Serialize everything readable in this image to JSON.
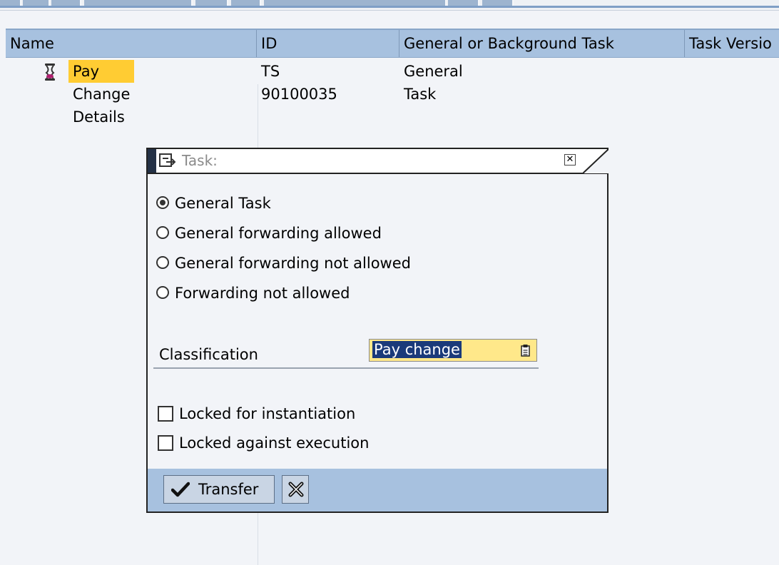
{
  "grid": {
    "columns": [
      "Name",
      "ID",
      "General or Background Task",
      "Task Versio"
    ],
    "rows": [
      {
        "name": "Pay Change Details",
        "id": "TS 90100035",
        "type": "General Task",
        "icon": "task-node-icon"
      }
    ]
  },
  "dialog": {
    "title": "Task:",
    "radio_options": [
      {
        "label": "General Task",
        "selected": true
      },
      {
        "label": "General forwarding allowed",
        "selected": false
      },
      {
        "label": "General forwarding not allowed",
        "selected": false
      },
      {
        "label": "Forwarding not allowed",
        "selected": false
      }
    ],
    "classification": {
      "label": "Classification",
      "value": "Pay change"
    },
    "checkboxes": [
      {
        "label": "Locked for instantiation",
        "checked": false
      },
      {
        "label": "Locked against execution",
        "checked": false
      }
    ],
    "footer": {
      "transfer_label": "Transfer",
      "transfer_icon": "checkmark-icon",
      "cancel_icon": "cancel-x-icon"
    }
  },
  "colors": {
    "header_bg": "#a7c1df",
    "selection_highlight": "#ffcc33",
    "input_bg": "#ffe88a",
    "text_selection": "#1a3a7a"
  }
}
